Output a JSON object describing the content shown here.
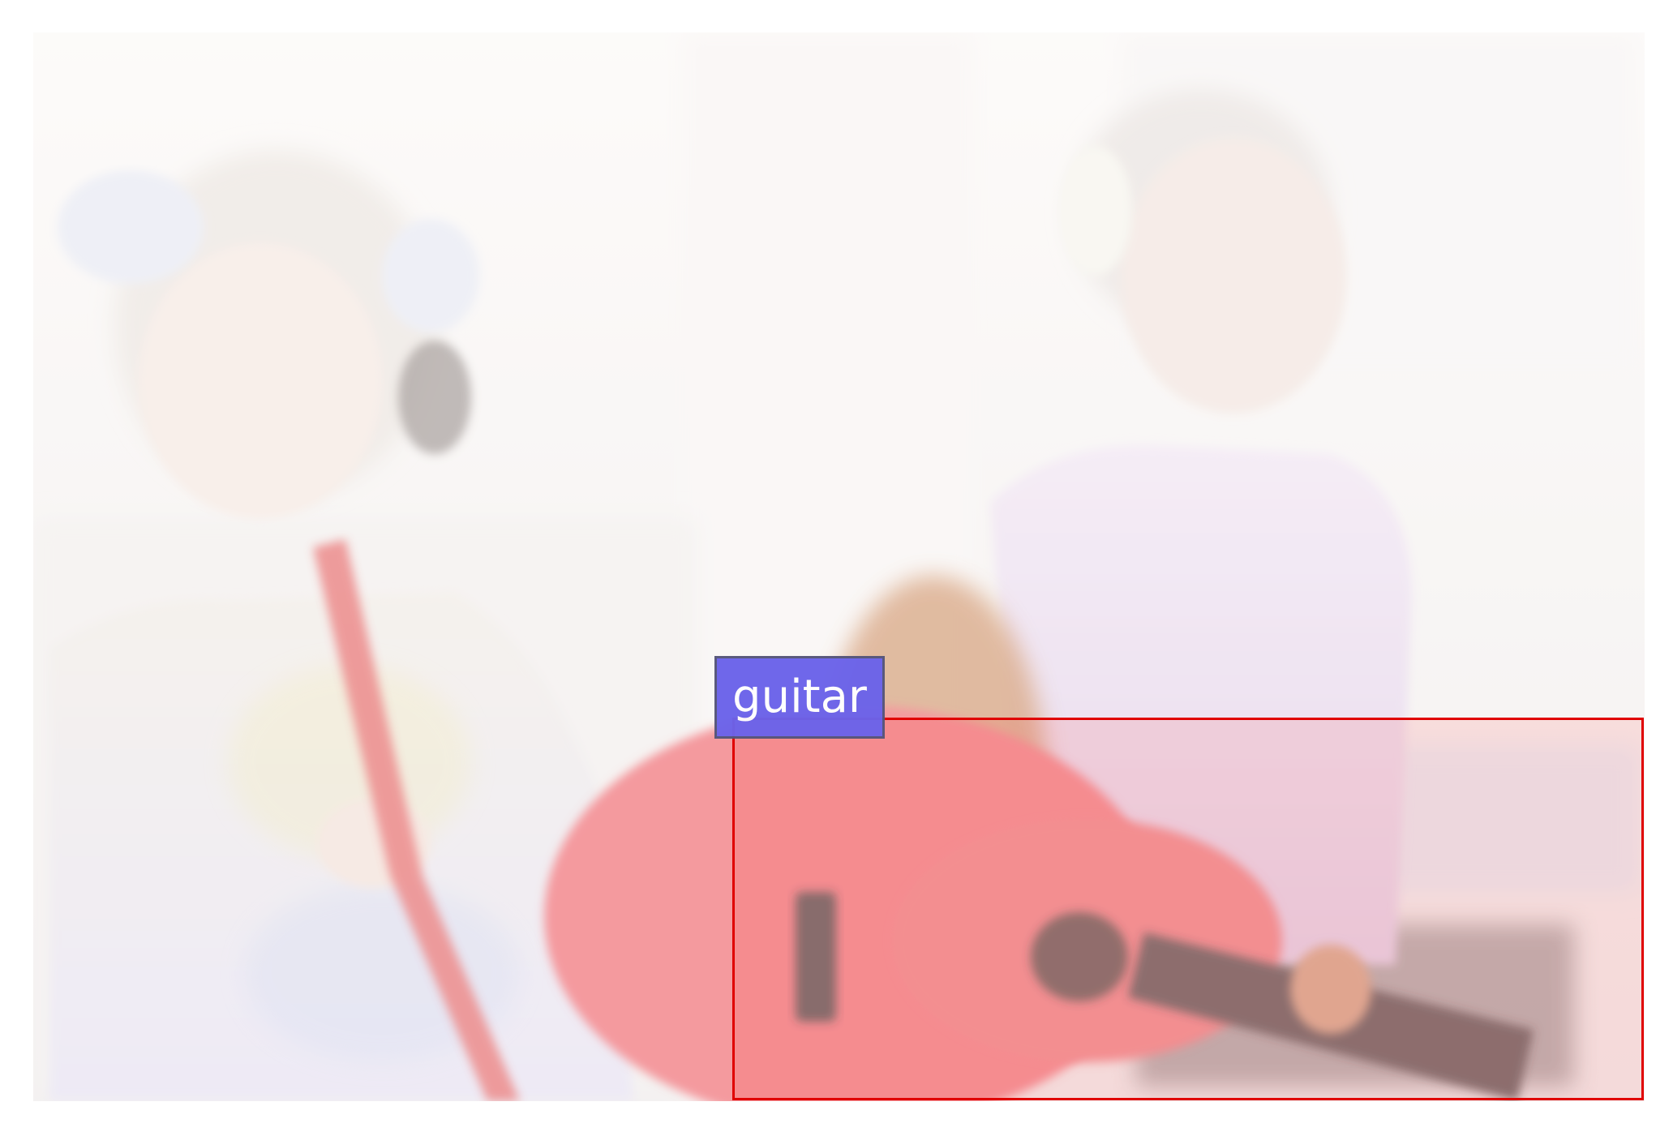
{
  "detections": [
    {
      "label": "guitar",
      "box_color": "#e00000",
      "tag_color": "#6b63ea"
    }
  ],
  "scene": {
    "objects": [
      "girl-with-recorder",
      "girl-with-guitar",
      "recorder",
      "guitar"
    ]
  }
}
